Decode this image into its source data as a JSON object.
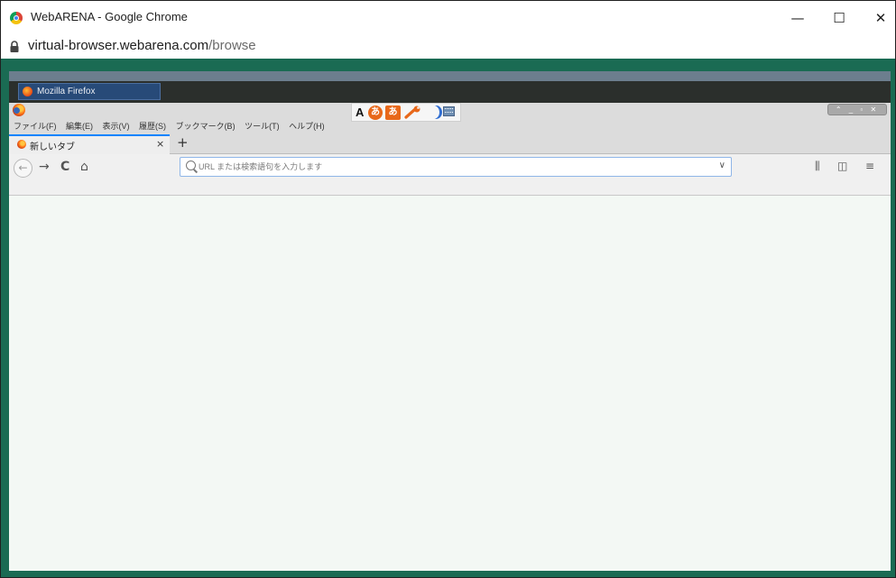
{
  "window": {
    "title": "WebARENA - Google Chrome",
    "minimize": "—",
    "maximize": "☐",
    "close": "✕"
  },
  "address": {
    "host": "virtual-browser.webarena.com",
    "path": "/browse"
  },
  "vm": {
    "taskbar": {
      "button_label": "Mozilla Firefox"
    },
    "firefox": {
      "menu": [
        "ファイル(F)",
        "編集(E)",
        "表示(V)",
        "履歴(S)",
        "ブックマーク(B)",
        "ツール(T)",
        "ヘルプ(H)"
      ],
      "tab": {
        "label": "新しいタブ",
        "close": "×",
        "new_tab": "+"
      },
      "nav": {
        "back": "←",
        "forward": "→",
        "reload": "C",
        "home": "⌂",
        "dropdown": "∨",
        "library": "⫼",
        "sidebar": "◫",
        "menu": "≡"
      },
      "urlbar": {
        "placeholder": "URL または検索語句を入力します",
        "value": ""
      },
      "ime": {
        "glyph1": "A",
        "circle_char": "あ",
        "square_char": "あ",
        "colors": {
          "orange": "#e8681a",
          "blue": "#2f6dd1"
        }
      },
      "wm_controls": "⌃ _ ▫ ✕"
    }
  },
  "colors": {
    "teal_background": "#1a6b53",
    "content_background": "#f3f8f4",
    "tab_accent": "#0a84ff"
  }
}
